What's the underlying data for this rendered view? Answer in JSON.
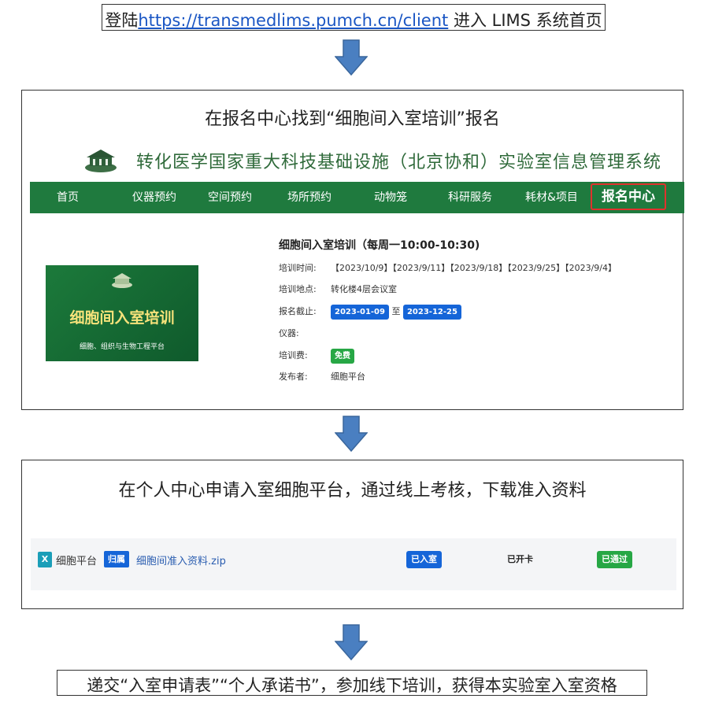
{
  "step1": {
    "prefix": "登陆",
    "url": "https://transmedlims.pumch.cn/client",
    "suffix": " 进入 LIMS 系统首页"
  },
  "step2": {
    "caption": "在报名中心找到“细胞间入室培训”报名",
    "system_title": "转化医学国家重大科技基础设施（北京协和）实验室信息管理系统",
    "nav": [
      "首页",
      "仪器预约",
      "空间预约",
      "场所预约",
      "动物笼",
      "科研服务",
      "耗材&项目",
      "报名中心"
    ],
    "image": {
      "title": "细胞间入室培训",
      "subtitle": "细胞、组织与生物工程平台"
    },
    "course": {
      "title": "细胞间入室培训（每周一10:00-10:30)",
      "time_label": "培训时间:",
      "time_value": "【2023/10/9】【2023/9/11】【2023/9/18】【2023/9/25】【2023/9/4】",
      "place_label": "培训地点:",
      "place_value": "转化楼4层会议室",
      "deadline_label": "报名截止:",
      "deadline_start": "2023-01-09",
      "deadline_sep": "至",
      "deadline_end": "2023-12-25",
      "instrument_label": "仪器:",
      "fee_label": "培训费:",
      "fee_value": "免费",
      "publisher_label": "发布者:",
      "publisher_value": "细胞平台"
    }
  },
  "step3": {
    "caption": "在个人中心申请入室细胞平台，通过线上考核，下载准入资料",
    "file": {
      "icon_letter": "X",
      "platform": "细胞平台",
      "tag": "归属",
      "filename": "细胞间准入资料.zip",
      "status_entered": "已入室",
      "status_card": "已开卡",
      "status_passed": "已通过"
    }
  },
  "step4": {
    "text": "递交“入室申请表”“个人承诺书”，参加线下培训，获得本实验室入室资格"
  },
  "colors": {
    "nav_green": "#1f7a3e",
    "arrow_blue": "#4a7fc1",
    "chip_blue": "#1565d8",
    "chip_green": "#27a745",
    "active_border": "#e0322d"
  }
}
